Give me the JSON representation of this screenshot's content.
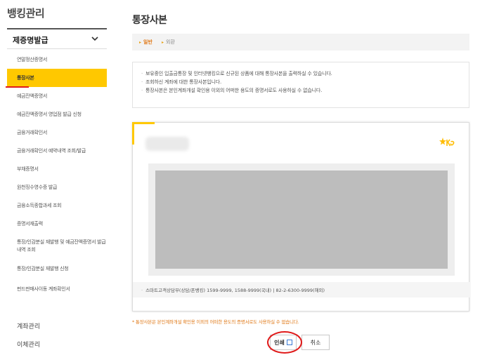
{
  "sidebar": {
    "title": "뱅킹관리",
    "section": "제증명발급",
    "items": [
      {
        "label": "연말정산증명서",
        "active": false
      },
      {
        "label": "통장사본",
        "active": true
      },
      {
        "label": "예금잔액증명서",
        "active": false
      },
      {
        "label": "예금잔액증명서 영업점 발급 신청",
        "active": false
      },
      {
        "label": "금융거래확인서",
        "active": false
      },
      {
        "label": "금융거래확인서 예약내역 조회/발급",
        "active": false
      },
      {
        "label": "부채증명서",
        "active": false
      },
      {
        "label": "원천징수영수증 발급",
        "active": false
      },
      {
        "label": "금융소득종합과세 조회",
        "active": false
      },
      {
        "label": "증명서재출력",
        "active": false
      },
      {
        "label": "통장/인감분실 재발행 및 예금잔액증명서 발급내역 조회",
        "active": false
      },
      {
        "label": "통장/인감분실 재발행 신청",
        "active": false
      },
      {
        "label": "펀드판매사이동 계좌확인서",
        "active": false
      }
    ],
    "bottom": [
      "계좌관리",
      "이체관리"
    ]
  },
  "main": {
    "title": "통장사본",
    "tabs": [
      {
        "label": "일반",
        "active": true
      },
      {
        "label": "외환",
        "active": false
      }
    ],
    "notes": [
      "보유중인 입출금통장 및 인터넷뱅킹으로 신규된 상품에 대해 통장사본을 출력하실 수 있습니다.",
      "조회하신 계좌에 대한 통장사본입니다.",
      "통장사본은 본인계좌개설 확인용 이외의 어떠한 용도의 증명서로도 사용하실 수 없습니다."
    ],
    "doc_footer": "스마트고객상담부(상담/폰뱅킹) 1599-9999, 1588-9999(국내) | 82-2-6300-9999(해외)",
    "warning": "* 통장사본은 본인계좌개설 확인용 이외의 어떠한 용도의 증명서로도 사용하실 수 없습니다.",
    "buttons": {
      "print": "인쇄",
      "cancel": "취소"
    }
  },
  "colors": {
    "accent": "#ffc800",
    "highlight": "#e01b1b",
    "warning": "#e07a1a"
  },
  "icons": {
    "section_toggle": "chevron-down-icon",
    "print": "print-icon",
    "brand": "kb-star-logo"
  }
}
